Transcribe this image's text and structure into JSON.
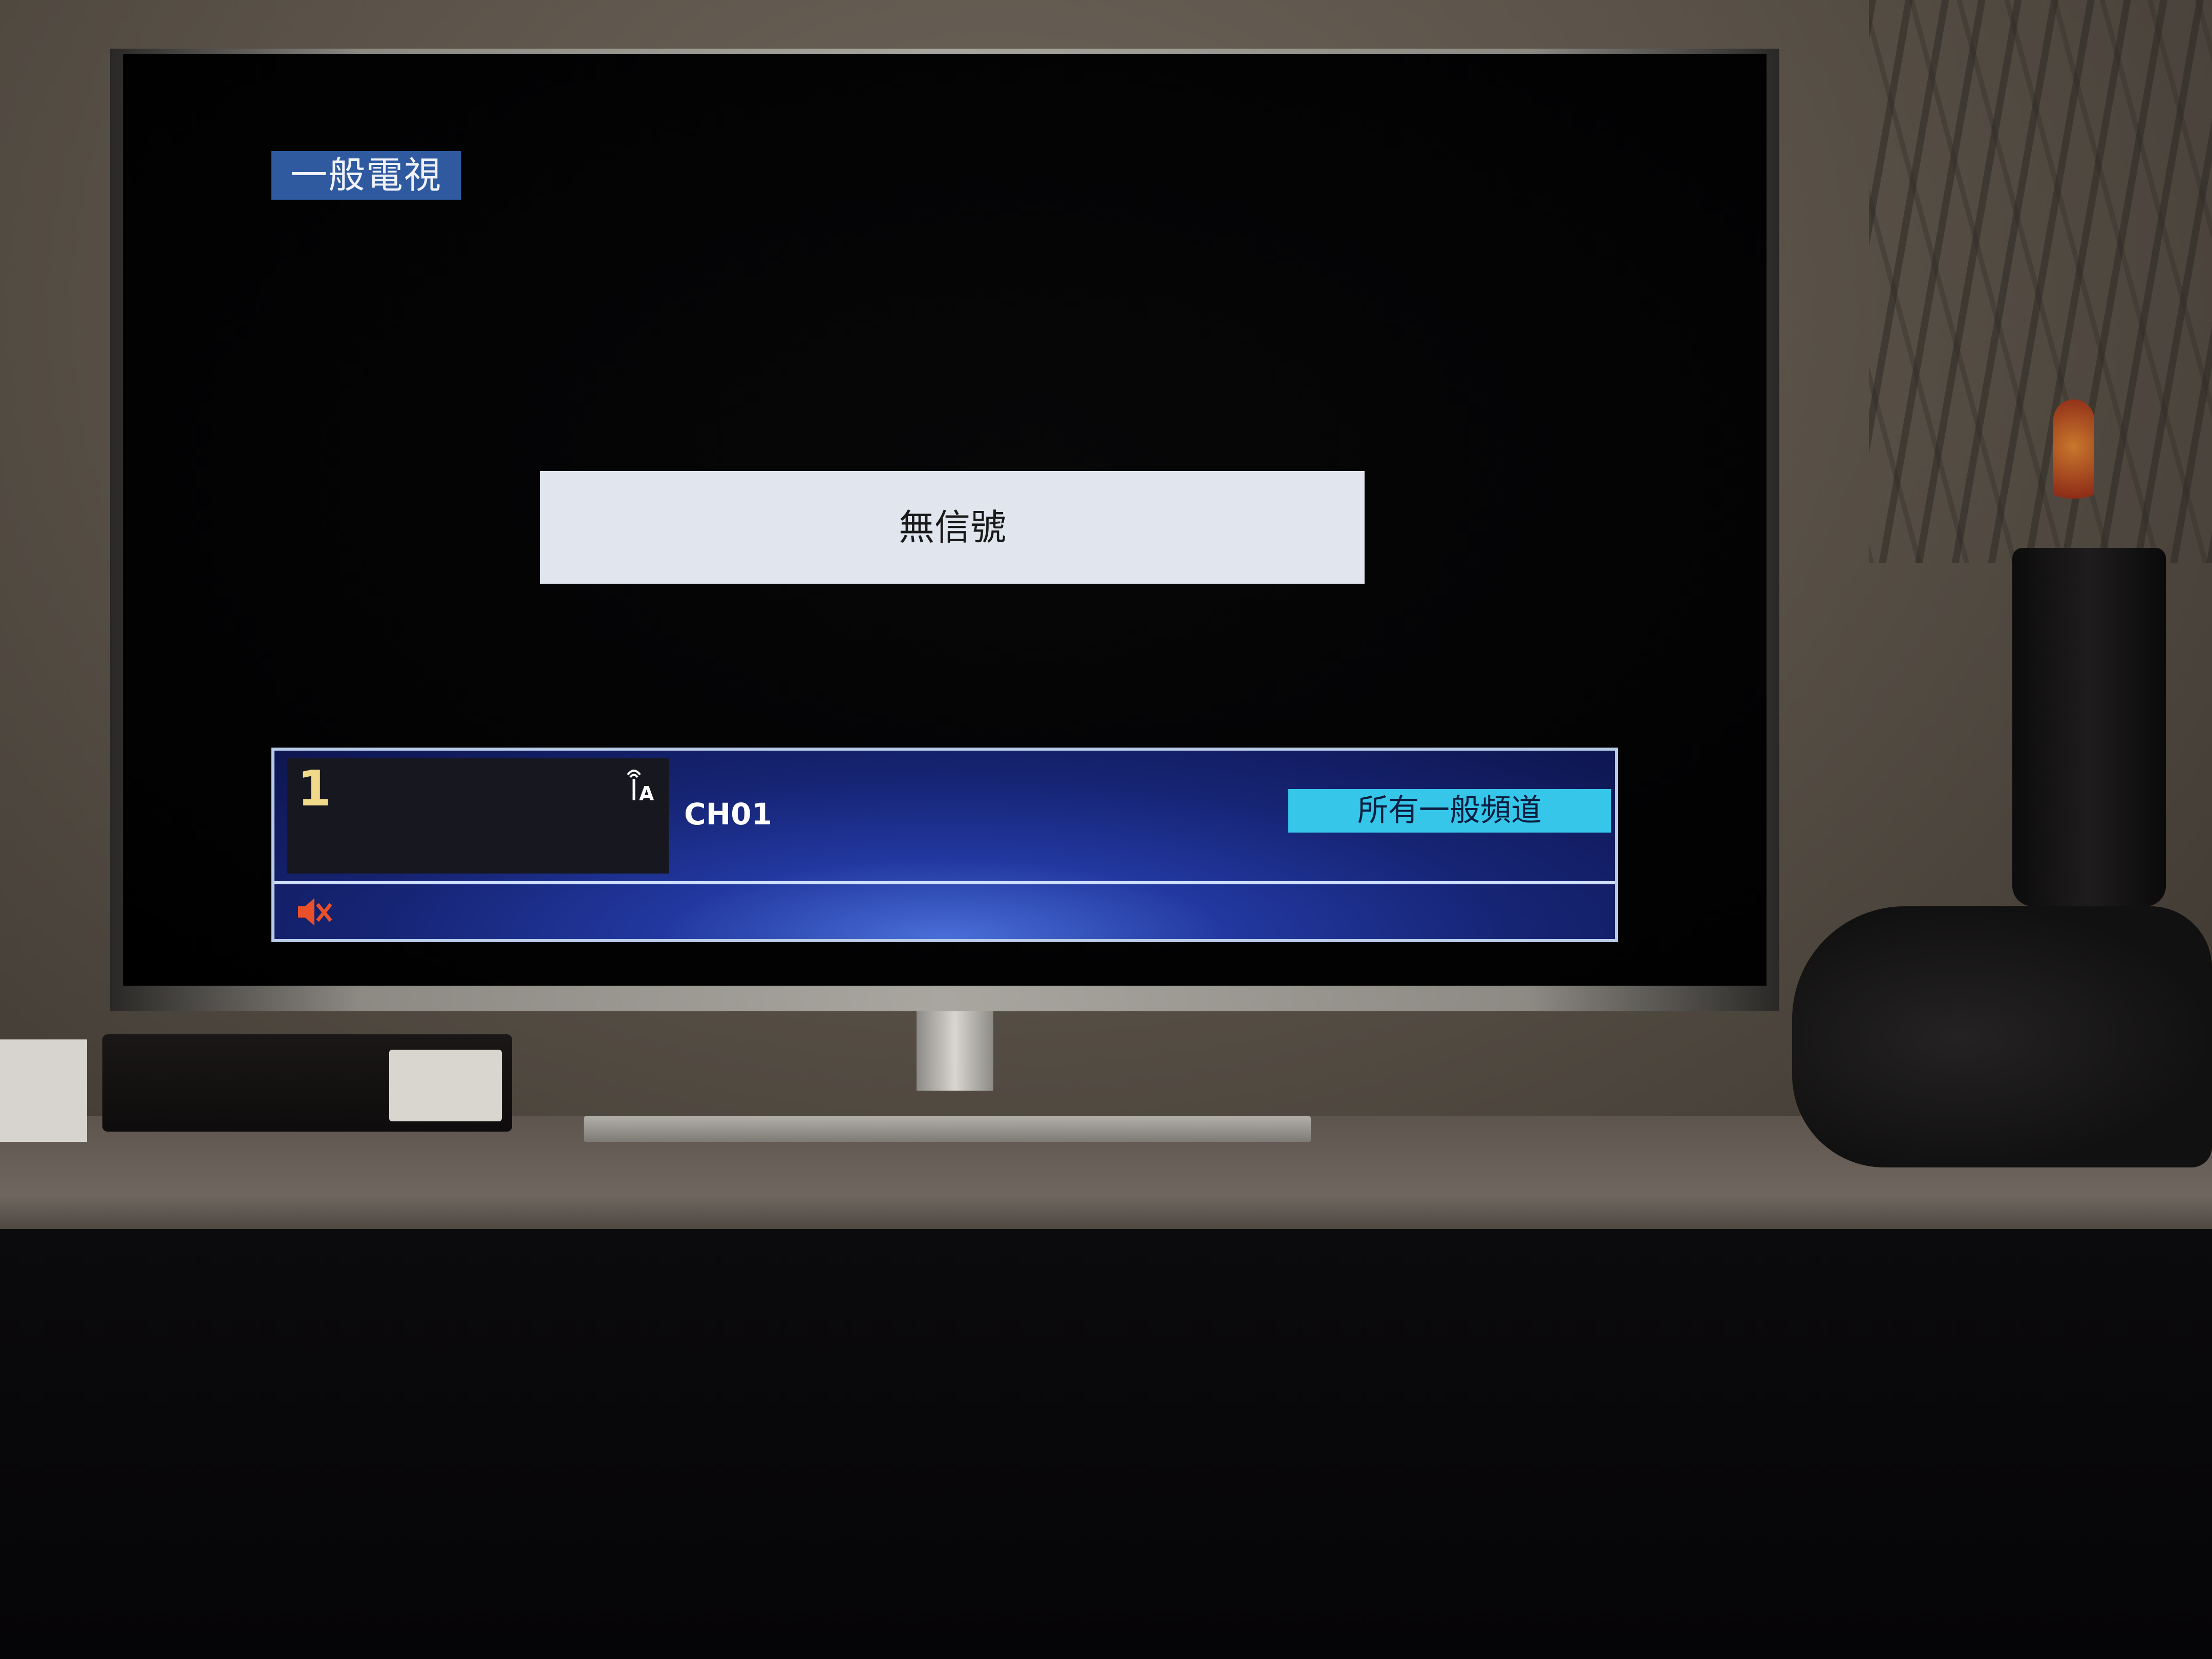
{
  "tv": {
    "source_badge": "一般電視",
    "message": "無信號",
    "channel_number": "1",
    "channel_name": "CH01",
    "group_label": "所有一般頻道",
    "icons": {
      "antenna": "antenna-icon",
      "mute": "mute-icon"
    }
  },
  "colors": {
    "badge_bg": "#2f5aa0",
    "group_bg": "#35c6ea",
    "channel_number": "#f1d98a",
    "mute": "#e8512a"
  }
}
